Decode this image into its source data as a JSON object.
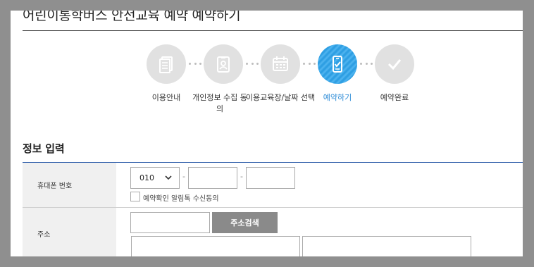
{
  "page": {
    "title": "어린이통학버스 안전교육 예약 예약하기"
  },
  "steps": [
    {
      "label": "이용안내",
      "icon": "document-icon"
    },
    {
      "label": "개인정보 수집 동의",
      "icon": "id-card-icon"
    },
    {
      "label": "이용교육장/날짜 선택",
      "icon": "calendar-icon"
    },
    {
      "label": "예약하기",
      "icon": "mobile-check-icon"
    },
    {
      "label": "예약완료",
      "icon": "checkmark-icon"
    }
  ],
  "active_step": 4,
  "colors": {
    "accent": "#2f9fe3",
    "step_idle": "#e1e1e1",
    "button": "#8a8a8a",
    "table_rule": "#2a5aa8"
  },
  "form": {
    "section_title": "정보 입력",
    "phone": {
      "label": "휴대폰 번호",
      "prefix": "010",
      "separator": "-",
      "consent_label": "예약확인 알림톡 수신동의"
    },
    "address": {
      "label": "주소",
      "search_button": "주소검색"
    }
  }
}
